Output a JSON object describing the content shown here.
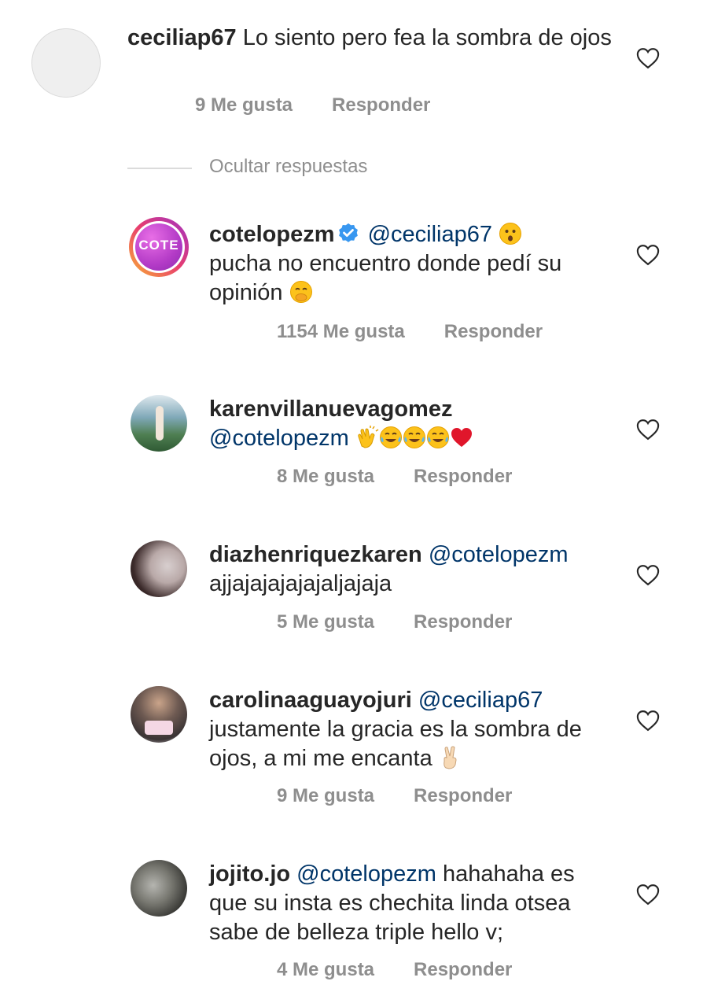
{
  "parent_comment": {
    "username": "ceciliap67",
    "text": "Lo siento pero fea la sombra de ojos",
    "likes": "9 Me gusta",
    "reply": "Responder"
  },
  "hide_replies": "Ocultar respuestas",
  "replies": [
    {
      "username": "cotelopezm",
      "verified": true,
      "mention": "@ceciliap67",
      "text": "pucha no encuentro donde pedí su opinión",
      "likes": "1154 Me gusta",
      "reply": "Responder",
      "avatar_label": "COTE"
    },
    {
      "username": "karenvillanuevagomez",
      "mention": "@cotelopezm",
      "text": "",
      "likes": "8 Me gusta",
      "reply": "Responder"
    },
    {
      "username": "diazhenriquezkaren",
      "mention": "@cotelopezm",
      "text": "ajjajajajajajaljajaja",
      "likes": "5 Me gusta",
      "reply": "Responder"
    },
    {
      "username": "carolinaaguayojuri",
      "mention": "@ceciliap67",
      "text": "justamente la gracia es la sombra de ojos, a mi me encanta",
      "likes": "9 Me gusta",
      "reply": "Responder"
    },
    {
      "username": "jojito.jo",
      "mention": "@cotelopezm",
      "text": "hahahaha es que su insta es chechita linda otsea sabe de belleza triple hello v;",
      "likes": "4 Me gusta",
      "reply": "Responder"
    }
  ],
  "colors": {
    "text": "#262626",
    "meta": "#8e8e8e",
    "mention": "#003569",
    "verified": "#3897f0"
  }
}
